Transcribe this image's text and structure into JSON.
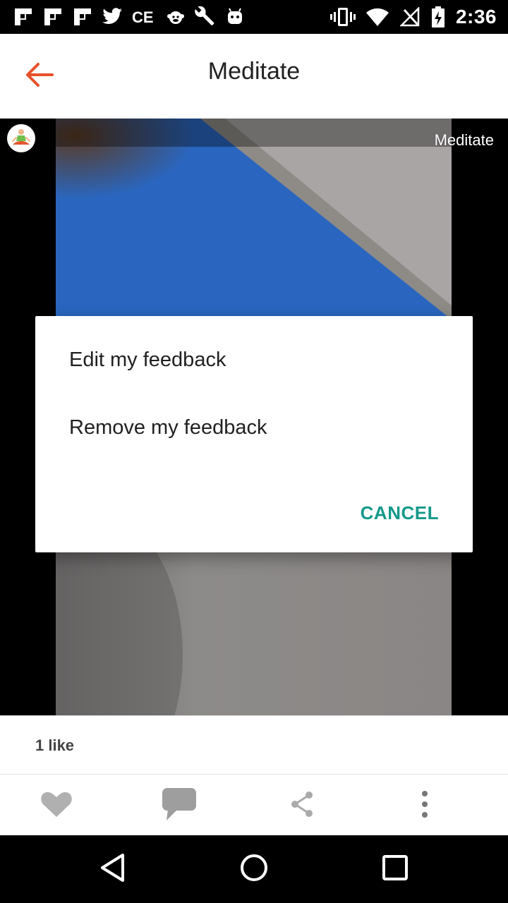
{
  "status_bar": {
    "time": "2:36",
    "left_icons": [
      "flipboard-icon",
      "flipboard-icon",
      "flipboard-icon",
      "twitter-icon",
      "ce-icon",
      "monkey-icon",
      "wrench-icon",
      "android-icon"
    ],
    "right_icons": [
      "vibrate-icon",
      "wifi-icon",
      "no-signal-icon",
      "battery-charging-icon"
    ]
  },
  "app_bar": {
    "title": "Meditate",
    "accent_color": "#e8502a"
  },
  "media": {
    "caption": "Meditate"
  },
  "dialog": {
    "items": [
      "Edit my feedback",
      "Remove my feedback"
    ],
    "cancel_label": "CANCEL",
    "accent_color": "#14998a"
  },
  "likes": {
    "text": "1 like"
  },
  "actions": [
    "heart-icon",
    "comment-icon",
    "share-icon",
    "more-icon"
  ],
  "nav": [
    "back-icon",
    "home-icon",
    "recents-icon"
  ]
}
